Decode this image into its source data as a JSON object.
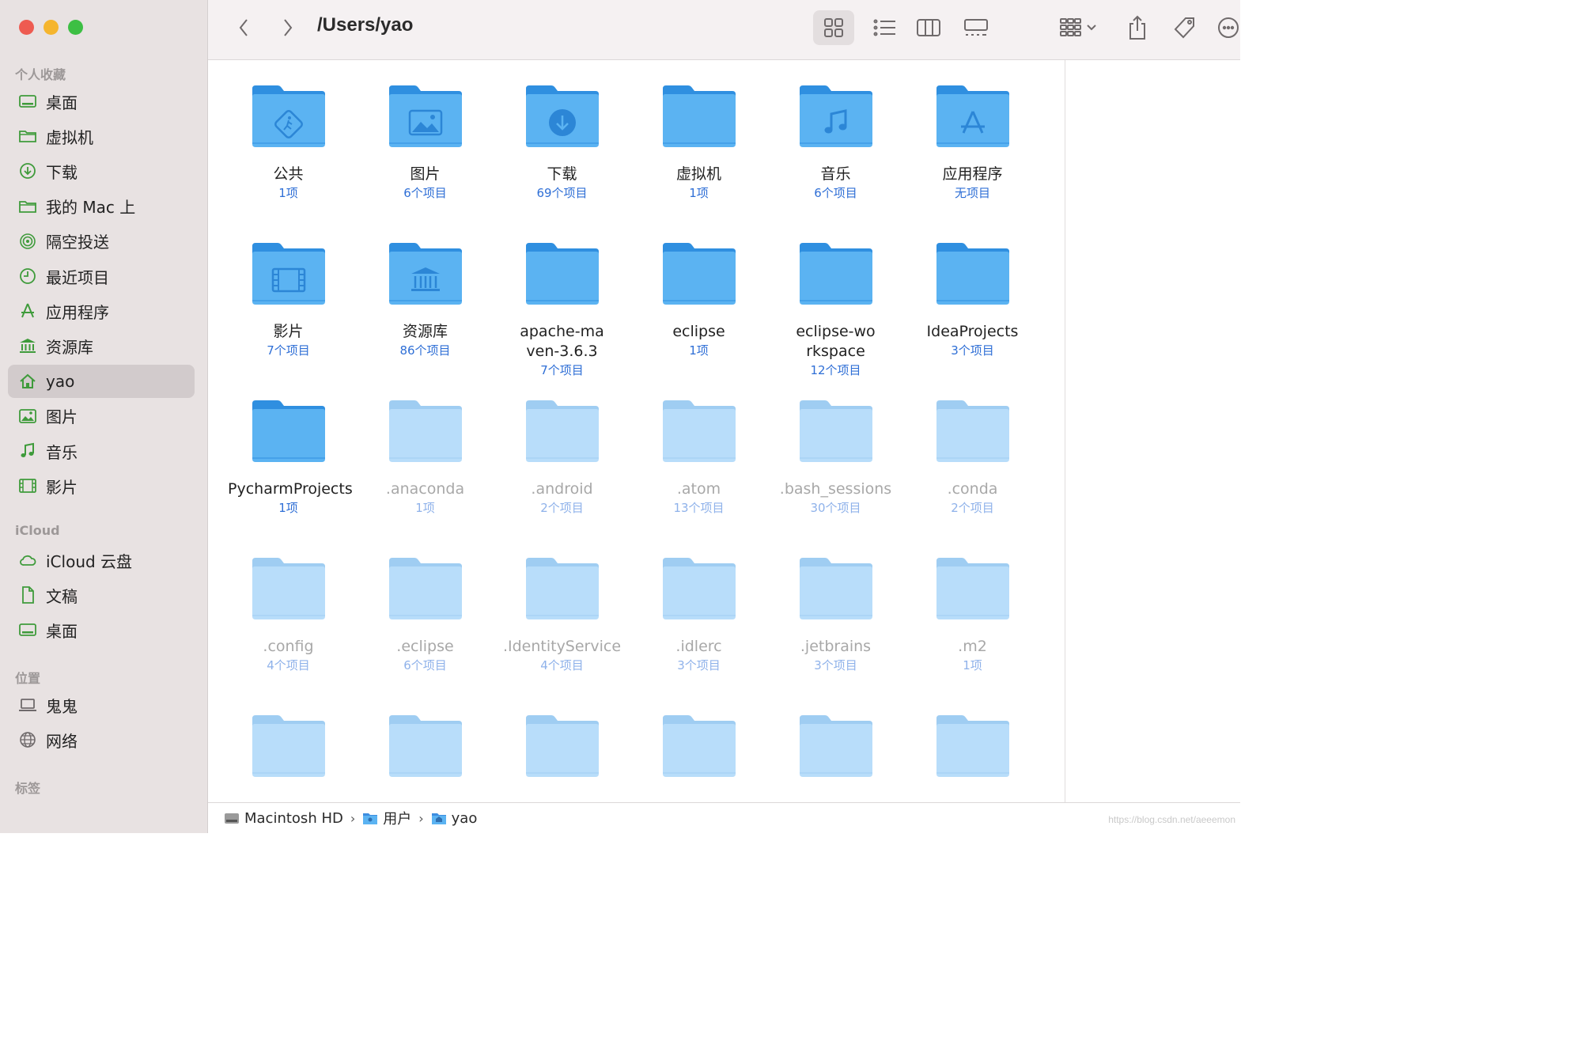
{
  "window": {
    "title": "/Users/yao"
  },
  "sidebar": {
    "favorites_title": "个人收藏",
    "favorites": [
      {
        "label": "桌面",
        "icon": "desktop-icon"
      },
      {
        "label": "虚拟机",
        "icon": "folder-icon"
      },
      {
        "label": "下载",
        "icon": "download-icon"
      },
      {
        "label": "我的 Mac 上",
        "icon": "folder-icon"
      },
      {
        "label": "隔空投送",
        "icon": "airdrop-icon"
      },
      {
        "label": "最近项目",
        "icon": "clock-icon"
      },
      {
        "label": "应用程序",
        "icon": "apps-icon"
      },
      {
        "label": "资源库",
        "icon": "library-icon"
      },
      {
        "label": "yao",
        "icon": "home-icon",
        "selected": true
      },
      {
        "label": "图片",
        "icon": "pictures-icon"
      },
      {
        "label": "音乐",
        "icon": "music-icon"
      },
      {
        "label": "影片",
        "icon": "movies-icon"
      }
    ],
    "icloud_title": "iCloud",
    "icloud": [
      {
        "label": "iCloud 云盘",
        "icon": "cloud-icon"
      },
      {
        "label": "文稿",
        "icon": "document-icon"
      },
      {
        "label": "桌面",
        "icon": "desktop-icon"
      }
    ],
    "locations_title": "位置",
    "locations": [
      {
        "label": "鬼鬼",
        "icon": "laptop-icon"
      },
      {
        "label": "网络",
        "icon": "network-icon"
      }
    ],
    "tags_title": "标签"
  },
  "files": [
    {
      "name": "公共",
      "count": "1项",
      "emblem": "public",
      "hidden": false
    },
    {
      "name": "图片",
      "count": "6个项目",
      "emblem": "pictures",
      "hidden": false
    },
    {
      "name": "下载",
      "count": "69个项目",
      "emblem": "downloads",
      "hidden": false
    },
    {
      "name": "虚拟机",
      "count": "1项",
      "emblem": "",
      "hidden": false
    },
    {
      "name": "音乐",
      "count": "6个项目",
      "emblem": "music",
      "hidden": false
    },
    {
      "name": "应用程序",
      "count": "无项目",
      "emblem": "apps",
      "hidden": false
    },
    {
      "name": "影片",
      "count": "7个项目",
      "emblem": "movies",
      "hidden": false
    },
    {
      "name": "资源库",
      "count": "86个项目",
      "emblem": "library",
      "hidden": false
    },
    {
      "name": "apache-maven-3.6.3",
      "count": "7个项目",
      "emblem": "",
      "hidden": false
    },
    {
      "name": "eclipse",
      "count": "1项",
      "emblem": "",
      "hidden": false
    },
    {
      "name": "eclipse-workspace",
      "count": "12个项目",
      "emblem": "",
      "hidden": false
    },
    {
      "name": "IdeaProjects",
      "count": "3个项目",
      "emblem": "",
      "hidden": false
    },
    {
      "name": "PycharmProjects",
      "count": "1项",
      "emblem": "",
      "hidden": false
    },
    {
      "name": ".anaconda",
      "count": "1项",
      "emblem": "",
      "hidden": true
    },
    {
      "name": ".android",
      "count": "2个项目",
      "emblem": "",
      "hidden": true
    },
    {
      "name": ".atom",
      "count": "13个项目",
      "emblem": "",
      "hidden": true
    },
    {
      "name": ".bash_sessions",
      "count": "30个项目",
      "emblem": "",
      "hidden": true
    },
    {
      "name": ".conda",
      "count": "2个项目",
      "emblem": "",
      "hidden": true
    },
    {
      "name": ".config",
      "count": "4个项目",
      "emblem": "",
      "hidden": true
    },
    {
      "name": ".eclipse",
      "count": "6个项目",
      "emblem": "",
      "hidden": true
    },
    {
      "name": ".IdentityService",
      "count": "4个项目",
      "emblem": "",
      "hidden": true
    },
    {
      "name": ".idlerc",
      "count": "3个项目",
      "emblem": "",
      "hidden": true
    },
    {
      "name": ".jetbrains",
      "count": "3个项目",
      "emblem": "",
      "hidden": true
    },
    {
      "name": ".m2",
      "count": "1项",
      "emblem": "",
      "hidden": true
    },
    {
      "name": "",
      "count": "",
      "emblem": "",
      "hidden": true
    },
    {
      "name": "",
      "count": "",
      "emblem": "",
      "hidden": true
    },
    {
      "name": "",
      "count": "",
      "emblem": "",
      "hidden": true
    },
    {
      "name": "",
      "count": "",
      "emblem": "",
      "hidden": true
    },
    {
      "name": "",
      "count": "",
      "emblem": "",
      "hidden": true
    },
    {
      "name": "",
      "count": "",
      "emblem": "",
      "hidden": true
    }
  ],
  "pathbar": {
    "segments": [
      {
        "label": "Macintosh HD",
        "icon": "hard-drive-icon"
      },
      {
        "label": "用户",
        "icon": "folder-icon"
      },
      {
        "label": "yao",
        "icon": "home-folder-icon"
      }
    ],
    "separator": "›"
  },
  "watermark": "https://blog.csdn.net/aeeemon",
  "colors": {
    "accent": "#2f6fd6",
    "sidebar_icon": "#3f9b3b",
    "folder": "#5bb3f2"
  }
}
